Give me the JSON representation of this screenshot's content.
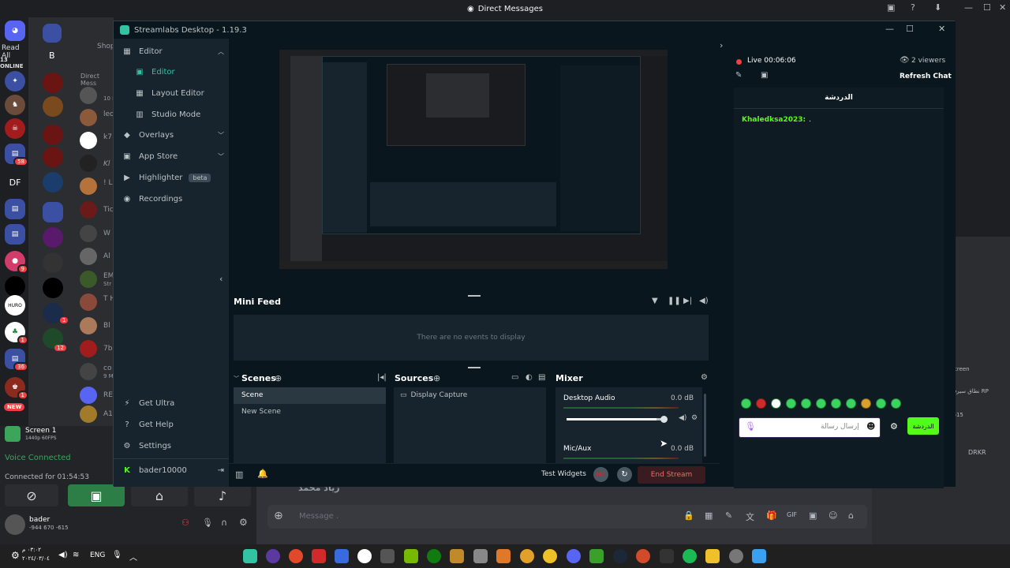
{
  "discord": {
    "window_title": "Direct Messages",
    "read_all": "Read All",
    "online_count": "13 ONLINE",
    "server_letters": [
      "B",
      "DF"
    ],
    "server_badges": [
      "58",
      "9",
      "1",
      "1",
      "12",
      "36",
      "1"
    ],
    "new_label": "NEW",
    "dm_names": [
      "Shop",
      "Direct Mess",
      "leo",
      "k7",
      "Kl",
      "! L",
      "Tic",
      "W",
      "Al",
      "EM",
      "T H",
      "Bl",
      "7b",
      "co",
      "RE",
      "A1"
    ],
    "dm_sub": [
      "10 M",
      "Str",
      "9 M"
    ],
    "screen_share": {
      "title": "Screen 1",
      "detail": "1440p 60FPS"
    },
    "voice_connected": "Voice Connected",
    "connected_for": "Connected for 01:54:53",
    "user": {
      "name": "bader",
      "status": "-944 670 -615"
    },
    "message_placeholder": "Message .",
    "right_snippets": [
      "creen",
      "نطاق سيرفر RP",
      "DRKR",
      "-615"
    ],
    "chat_author": "زياد محمد"
  },
  "streamlabs": {
    "title": "Streamlabs Desktop - 1.19.3",
    "nav": {
      "editor_group": "Editor",
      "editor": "Editor",
      "layout_editor": "Layout Editor",
      "studio_mode": "Studio Mode",
      "overlays": "Overlays",
      "app_store": "App Store",
      "highlighter": "Highlighter",
      "beta": "beta",
      "recordings": "Recordings",
      "get_ultra": "Get Ultra",
      "get_help": "Get Help",
      "settings": "Settings",
      "account": "bader10000"
    },
    "minifeed": {
      "title": "Mini Feed",
      "empty": "There are no events to display"
    },
    "scenes": {
      "title": "Scenes",
      "items": [
        "Scene",
        "New Scene"
      ]
    },
    "sources": {
      "title": "Sources",
      "items": [
        "Display Capture"
      ]
    },
    "mixer": {
      "title": "Mixer",
      "channels": [
        {
          "name": "Desktop Audio",
          "db": "0.0 dB",
          "level": 0.92
        },
        {
          "name": "Mic/Aux",
          "db": "0.0 dB",
          "level": 0.92
        }
      ]
    },
    "bottom": {
      "test_widgets": "Test Widgets",
      "rec": "REC",
      "end_stream": "End Stream"
    },
    "chat": {
      "live": "Live 00:06:06",
      "viewers": "2 viewers",
      "refresh": "Refresh Chat",
      "tab": "الدردشة",
      "messages": [
        {
          "author": "Khaledksa2023:",
          "text": "."
        }
      ],
      "input_placeholder": "إرسال رسالة",
      "send": "الدردشة"
    }
  },
  "taskbar": {
    "lang": "ENG",
    "time": "٠٣:٠٢ م",
    "date": "٢٠٢٤/٠٣/٠٤"
  },
  "colors": {
    "accent": "#31c3a2",
    "discord_bg": "#1e1f22",
    "end_stream": "#d12a2a",
    "chat_green": "#3ad45e"
  }
}
